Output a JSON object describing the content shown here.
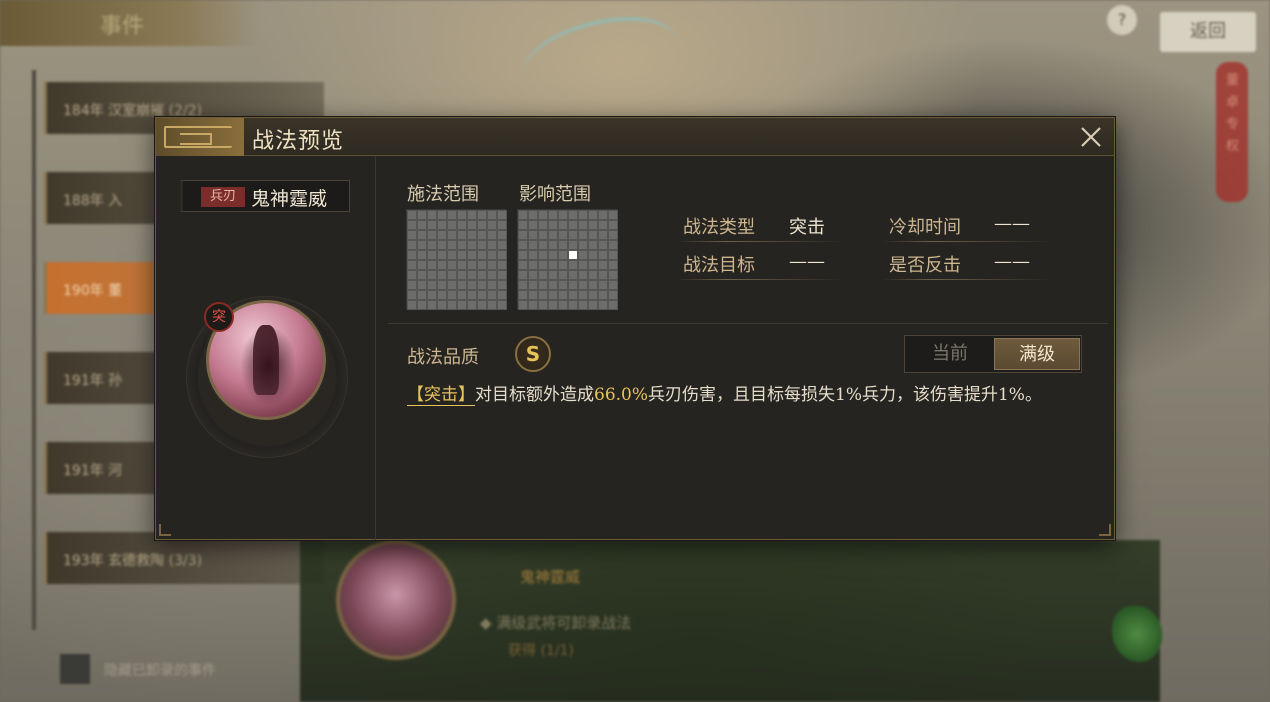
{
  "background": {
    "screen_title": "事件",
    "help_label": "?",
    "back_label": "返回",
    "events": [
      {
        "label": "184年 汉室崩摧 (2/2)"
      },
      {
        "label": "188年 入"
      },
      {
        "label": "190年 董"
      },
      {
        "label": "191年 孙"
      },
      {
        "label": "191年 河"
      },
      {
        "label": "193年 玄德救陶 (3/3)"
      }
    ],
    "bottom_skill_name": "鬼神霆威",
    "bottom_desc": "◆ 满级武将可卸录战法",
    "bottom_progress": "获得 (1/1)",
    "hide_label": "隐藏已卸录的事件",
    "banner_text": "董卓专权"
  },
  "modal": {
    "title": "战法预览",
    "close_icon": "close-x-icon",
    "troop_tag": "兵刃",
    "tactic_name": "鬼神霆威",
    "type_badge": "突",
    "cast_range_label": "施法范围",
    "effect_range_label": "影响范围",
    "effect_range_active_cells": [
      [
        4,
        5
      ]
    ],
    "fields": {
      "type_label": "战法类型",
      "type_value": "突击",
      "cooldown_label": "冷却时间",
      "cooldown_value": "——",
      "target_label": "战法目标",
      "target_value": "——",
      "counter_label": "是否反击",
      "counter_value": "——"
    },
    "quality_label": "战法品质",
    "quality_value": "S",
    "toggle": {
      "current": "当前",
      "max": "满级",
      "selected": "max"
    },
    "desc": {
      "tag": "【突击】",
      "part1": "对目标额外造成",
      "percent": "66.0%",
      "part2": "兵刃伤害，且目标每损失1%兵力，该伤害提升1%。"
    }
  },
  "colors": {
    "accent_gold": "#e8c35a",
    "panel_bg": "#262421",
    "label_tan": "#cdb690"
  }
}
